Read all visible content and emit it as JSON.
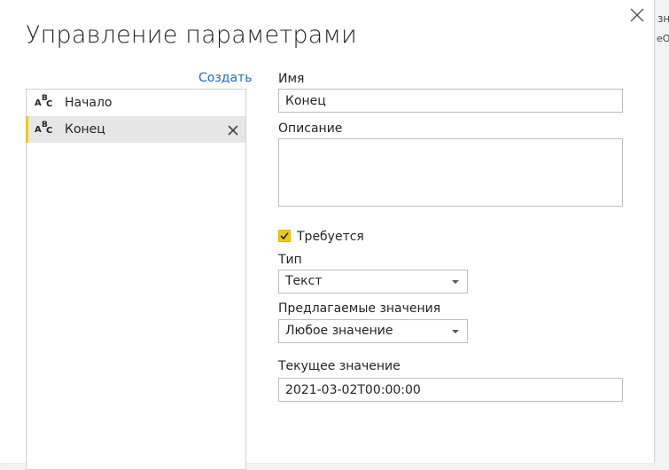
{
  "background": {
    "text_top": "зн",
    "text_bottom": "еОб"
  },
  "dialog": {
    "title": "Управление параметрами",
    "create_label": "Создать",
    "parameters": [
      {
        "label": "Начало",
        "type_icon": "abc-text-icon",
        "selected": false
      },
      {
        "label": "Конец",
        "type_icon": "abc-text-icon",
        "selected": true
      }
    ]
  },
  "form": {
    "name_label": "Имя",
    "name_value": "Конец",
    "description_label": "Описание",
    "description_value": "",
    "required_label": "Требуется",
    "required_checked": true,
    "type_label": "Тип",
    "type_value": "Текст",
    "suggested_label": "Предлагаемые значения",
    "suggested_value": "Любое значение",
    "current_label": "Текущее значение",
    "current_value": "2021-03-02T00:00:00"
  },
  "colors": {
    "accent": "#f2c811",
    "link": "#1e6fbd",
    "selected_row": "#e6e6e6"
  }
}
